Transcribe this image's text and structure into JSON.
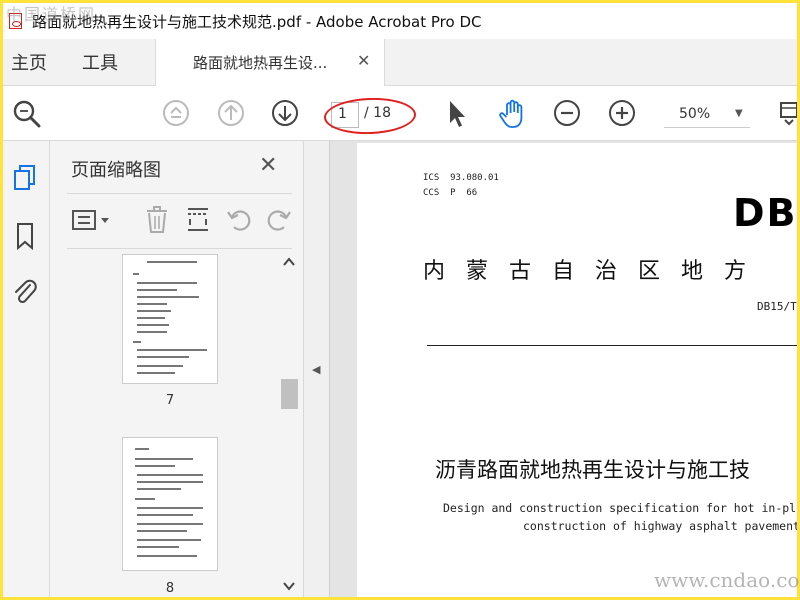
{
  "window": {
    "title": "路面就地热再生设计与施工技术规范.pdf - Adobe Acrobat Pro DC"
  },
  "tabs": {
    "home_label": "主页",
    "tools_label": "工具",
    "document_label": "路面就地热再生设..."
  },
  "toolbar": {
    "current_page": "1",
    "total_pages": "/ 18",
    "zoom_value": "50%"
  },
  "thumbnail_panel": {
    "title": "页面缩略图",
    "pages": [
      {
        "label": "7"
      },
      {
        "label": "8"
      }
    ]
  },
  "document_page": {
    "ics_line": "ICS  93.080.01",
    "ccs_line": "CCS  P  66",
    "standard_mark": "DB",
    "region_title": "内 蒙 古 自 治 区 地 方",
    "standard_number": "DB15/T",
    "main_title": "沥青路面就地热再生设计与施工技",
    "english_title_line1": "Design and construction specification for hot in-place",
    "english_title_line2": "construction of highway asphalt pavement"
  },
  "watermarks": {
    "top_left": "中国道桥网",
    "bottom_right": "www.cndao.com"
  },
  "colors": {
    "highlight_oval": "#e02020",
    "frame_border": "#ffe23c",
    "hand_tool_active": "#1473e6"
  }
}
